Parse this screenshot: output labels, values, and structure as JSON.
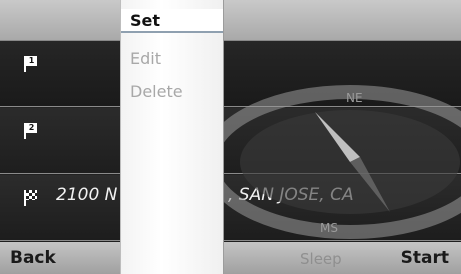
{
  "menu": {
    "items": [
      {
        "label": "Set",
        "selected": true
      },
      {
        "label": "Edit",
        "selected": false
      },
      {
        "label": "Delete",
        "selected": false
      }
    ]
  },
  "destinations": [
    {
      "number": "1",
      "text": ""
    },
    {
      "number": "2",
      "text": ""
    },
    {
      "number": "",
      "text": "2100 N",
      "text_right": ", SAN JOSE, CA"
    }
  ],
  "compass": {
    "ne": "NE",
    "sw": "MS"
  },
  "bottom": {
    "back": "Back",
    "middle": "Sleep",
    "start": "Start"
  },
  "colors": {
    "menu_bg": "#ffffff",
    "selected_underline": "#8fa0b0",
    "bar": "#b8b8b8"
  }
}
